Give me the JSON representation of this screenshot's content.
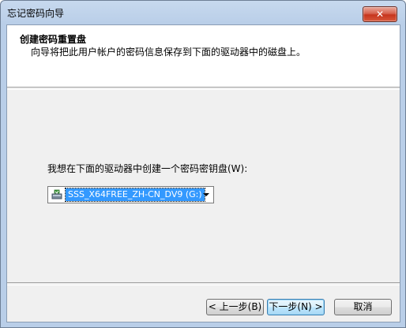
{
  "window": {
    "title": "忘记密码向导",
    "close_label": "✕"
  },
  "header": {
    "title": "创建密码重置盘",
    "subtitle": "向导将把此用户帐户的密码信息保存到下面的驱动器中的磁盘上。"
  },
  "main": {
    "prompt": "我想在下面的驱动器中创建一个密码密钥盘(W):",
    "drive_select": {
      "selected": "SSS_X64FREE_ZH-CN_DV9 (G:)",
      "icon": "drive-icon"
    }
  },
  "buttons": {
    "back": "< 上一步(B)",
    "next": "下一步(N) >",
    "cancel": "取消"
  },
  "colors": {
    "selection": "#3399ff",
    "close_button": "#c6351d"
  }
}
